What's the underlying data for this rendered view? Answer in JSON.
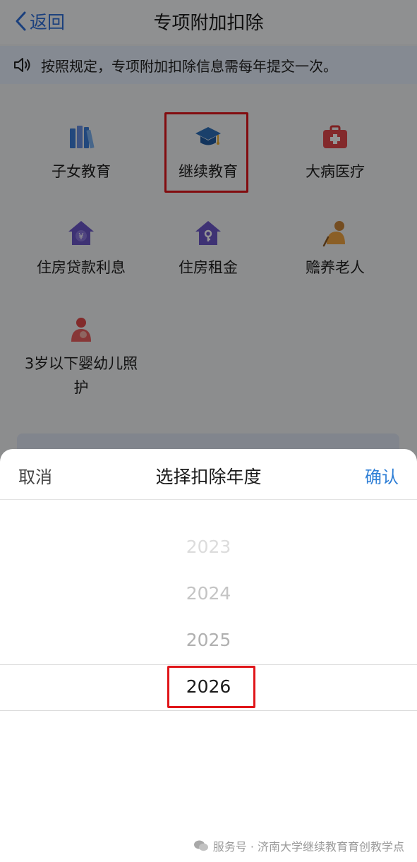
{
  "nav": {
    "back_label": "返回",
    "title": "专项附加扣除"
  },
  "notice": {
    "text": "按照规定，专项附加扣除信息需每年提交一次。"
  },
  "categories": [
    {
      "label": "子女教育",
      "icon": "books-icon"
    },
    {
      "label": "继续教育",
      "icon": "graduation-cap-icon"
    },
    {
      "label": "大病医疗",
      "icon": "medical-kit-icon"
    },
    {
      "label": "住房贷款利息",
      "icon": "house-yuan-icon"
    },
    {
      "label": "住房租金",
      "icon": "house-key-icon"
    },
    {
      "label": "赡养老人",
      "icon": "elderly-person-icon"
    },
    {
      "label": "3岁以下婴幼儿照护",
      "icon": "mother-baby-icon"
    }
  ],
  "sheet": {
    "cancel_label": "取消",
    "title": "选择扣除年度",
    "confirm_label": "确认",
    "years": [
      "2023",
      "2024",
      "2025",
      "2026"
    ],
    "selected_year": "2026"
  },
  "watermark": {
    "text": "服务号 · 济南大学继续教育育创教学点"
  },
  "colors": {
    "accent": "#2f7fd6",
    "highlight_border": "#e0161a"
  }
}
